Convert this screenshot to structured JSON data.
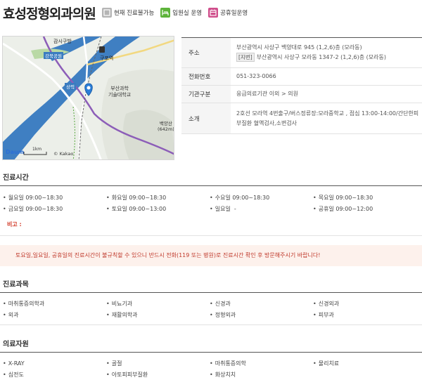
{
  "header": {
    "title": "효성정형외과의원",
    "badges": [
      {
        "label": "현재 진료불가능",
        "icon": "status-icon",
        "color": "#b5b5b5"
      },
      {
        "label": "입원실 운영",
        "icon": "bed-icon",
        "color": "#5db33a"
      },
      {
        "label": "공휴일운영",
        "icon": "calendar-icon",
        "color": "#d04f8c"
      }
    ]
  },
  "map": {
    "labels": {
      "station": "구포역",
      "park": "강북공원",
      "sangnyeon": "상력",
      "school1": "부산과학",
      "school2": "기술대학교",
      "mountain1": "백양산",
      "mountain2": "(642m)",
      "scale": "1km",
      "brand": "Daum",
      "copyright": "© Kakao",
      "top_label": "감시구방"
    }
  },
  "info": {
    "address_label": "주소",
    "address_road": "부산광역시 사상구 백양대로 945 (1,2,6)층 (모라동)",
    "address_jibun_tag": "[지번]",
    "address_jibun": "부산광역시 사상구 모라동 1347-2 (1,2,6)층 (모라동)",
    "phone_label": "전화번호",
    "phone": "051-323-0066",
    "type_label": "기관구분",
    "type": "응급의료기관 이외 > 의원",
    "intro_label": "소개",
    "intro_line1": "2호선 모라역 4번출구/버스정류장:모라중학교 , 점심 13:00-14:00/간단한피",
    "intro_line2": "부질환 혈액검사,소변검사"
  },
  "hours": {
    "title": "진료시간",
    "items": [
      "월요일 09:00~18:30",
      "화요일 09:00~18:30",
      "수요일 09:00~18:30",
      "목요일 09:00~18:30",
      "금요일 09:00~18:30",
      "토요일 09:00~13:00",
      "일요일  -",
      "공휴일 09:00~12:00"
    ],
    "note_label": "비고 :"
  },
  "notice": "토요일,일요일, 공휴일의 진료시간이 불규칙할 수 있으니 반드시 전화(119 또는 병원)로 진료시간 확인 후 방문해주시기 바랍니다!",
  "departments": {
    "title": "진료과목",
    "items": [
      "마취통증의학과",
      "비뇨기과",
      "신경과",
      "신경외과",
      "외과",
      "재활의학과",
      "정형외과",
      "피부과"
    ]
  },
  "resources": {
    "title": "의료자원",
    "items": [
      "X-RAY",
      "골절",
      "마취통증의학",
      "물리치료",
      "심전도",
      "아토피피부질환",
      "화상치치"
    ]
  }
}
